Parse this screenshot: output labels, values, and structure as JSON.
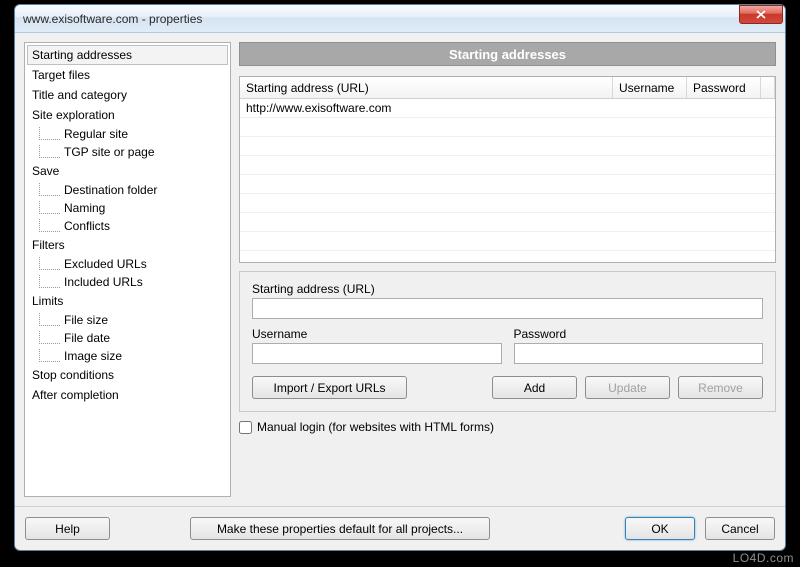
{
  "window": {
    "title": "www.exisoftware.com - properties"
  },
  "sidebar": {
    "items": [
      {
        "label": "Starting addresses",
        "selected": true
      },
      {
        "label": "Target files"
      },
      {
        "label": "Title and category"
      },
      {
        "label": "Site exploration",
        "children": [
          {
            "label": "Regular site"
          },
          {
            "label": "TGP site or page"
          }
        ]
      },
      {
        "label": "Save",
        "children": [
          {
            "label": "Destination folder"
          },
          {
            "label": "Naming"
          },
          {
            "label": "Conflicts"
          }
        ]
      },
      {
        "label": "Filters",
        "children": [
          {
            "label": "Excluded URLs"
          },
          {
            "label": "Included URLs"
          }
        ]
      },
      {
        "label": "Limits",
        "children": [
          {
            "label": "File size"
          },
          {
            "label": "File date"
          },
          {
            "label": "Image size"
          }
        ]
      },
      {
        "label": "Stop conditions"
      },
      {
        "label": "After completion"
      }
    ]
  },
  "panel": {
    "header": "Starting addresses",
    "columns": {
      "url": "Starting address (URL)",
      "user": "Username",
      "pass": "Password"
    },
    "rows": [
      {
        "url": "http://www.exisoftware.com",
        "user": "",
        "pass": ""
      }
    ],
    "form": {
      "url_label": "Starting address (URL)",
      "url_value": "",
      "user_label": "Username",
      "user_value": "",
      "pass_label": "Password",
      "pass_value": "",
      "btn_import": "Import / Export URLs",
      "btn_add": "Add",
      "btn_update": "Update",
      "btn_remove": "Remove"
    },
    "checkbox_label": "Manual login (for websites with HTML forms)"
  },
  "footer": {
    "help": "Help",
    "default": "Make these properties default for all projects...",
    "ok": "OK",
    "cancel": "Cancel"
  },
  "watermark": "LO4D.com"
}
